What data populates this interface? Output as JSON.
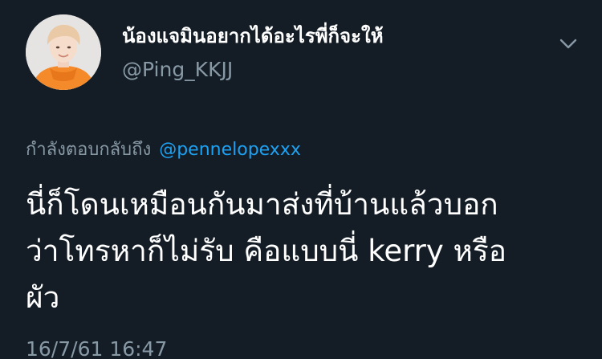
{
  "user": {
    "display_name": "น้องแจมินอยากได้อะไรพี่ก็จะให้",
    "handle": "@Ping_KKJJ"
  },
  "reply": {
    "prefix": "กำลังตอบกลับถึง",
    "mention": "@pennelopexxx"
  },
  "tweet": {
    "lines": [
      "นี่ก็โดนเหมือนกันมาส่งที่บ้านแล้วบอก",
      "ว่าโทรหาก็ไม่รับ คือแบบนี่  kerry หรือ",
      "ผัว"
    ]
  },
  "timestamp": "16/7/61 16:47",
  "icons": {
    "avatar": "profile-photo",
    "menu": "chevron-down-icon"
  },
  "colors": {
    "background": "#141d26",
    "secondary_text": "#8899a6",
    "link": "#1da1f2",
    "primary_text": "#ffffff"
  }
}
